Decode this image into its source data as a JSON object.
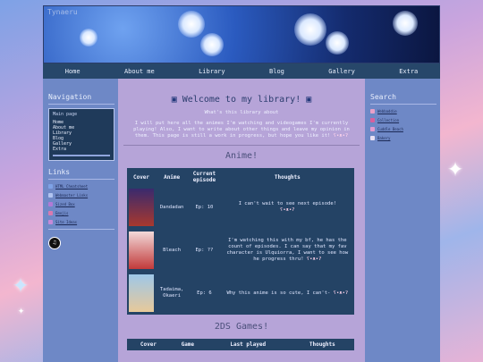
{
  "site_name": "Tynaeru",
  "nav": [
    "Home",
    "About me",
    "Library",
    "Blog",
    "Gallery",
    "Extra"
  ],
  "left": {
    "navigation_title": "Navigation",
    "box_title": "Main page",
    "box_items": [
      "Home",
      "About me",
      "Library",
      "Blog",
      "Gallery",
      "Extra"
    ],
    "links_title": "Links",
    "links": [
      {
        "label": "HTML Cheatsheet",
        "icon": "document-icon",
        "color": "#7ea2e6"
      },
      {
        "label": "Webmaster Links",
        "icon": "globe-icon",
        "color": "#b1c4f1"
      },
      {
        "label": "Sized Box",
        "icon": "gem-icon",
        "color": "#b07ad6"
      },
      {
        "label": "Emojis",
        "icon": "heart-icon",
        "color": "#d77ab0"
      },
      {
        "label": "Site Ideas",
        "icon": "bulb-icon",
        "color": "#c58ad8"
      }
    ]
  },
  "main": {
    "title": "Welcome to my library!",
    "subtitle": "What's this library about",
    "intro": "I will put here all the animes I'm watching and videogames I'm currently playing! Also, I want to write about other things and leave my opinion in them. This page is still a work in progress, but hope you like it!",
    "anime_heading": "Anime!",
    "anime_headers": [
      "Cover",
      "Anime",
      "Current episode",
      "Thoughts"
    ],
    "anime": [
      {
        "name": "Dandadan",
        "episode": "Ep: 10",
        "thoughts": "I can't wait to see next episode!",
        "cover": "#a8382e"
      },
      {
        "name": "Bleach",
        "episode": "Ep: ??",
        "thoughts": "I'm watching this with my bf, he has the count of episodes. I can say that my fav character is Ulquiorra, I want to see how he progress thru!",
        "cover": "#c23a3a"
      },
      {
        "name": "Tadaima, Okaeri",
        "episode": "Ep: 6",
        "thoughts": "Why this anime is so cute, I can't-",
        "cover": "#e7c99a"
      }
    ],
    "games_heading": "2DS Games!",
    "games_headers": [
      "Cover",
      "Game",
      "Last played",
      "Thoughts"
    ]
  },
  "right": {
    "search_title": "Search",
    "items": [
      {
        "label": "Webbaddie",
        "icon": "cursor-icon",
        "color": "#e8a0c8"
      },
      {
        "label": "Collection",
        "icon": "bow-icon",
        "color": "#d6609e"
      },
      {
        "label": "Cuddle Beach",
        "icon": "shell-icon",
        "color": "#e39ad0"
      },
      {
        "label": "Bakery",
        "icon": "cake-icon",
        "color": "#e8e0f4"
      }
    ]
  }
}
